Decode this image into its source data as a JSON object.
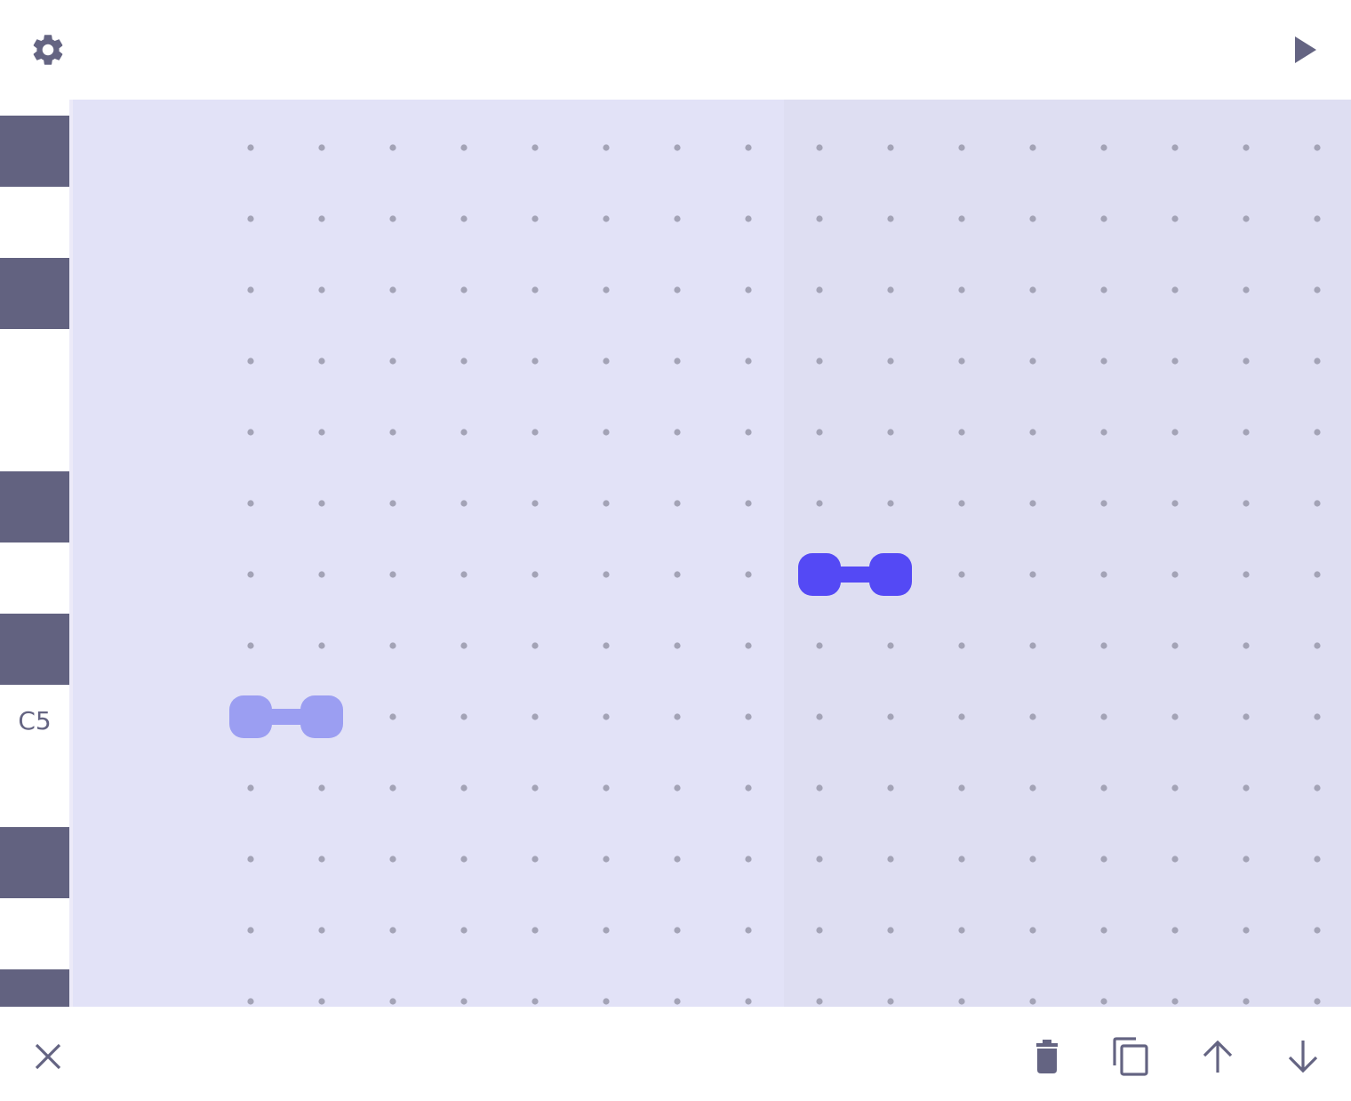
{
  "colors": {
    "icon": "#646482",
    "black_key": "#626280",
    "grid_bg_a": "#e2e2f7",
    "grid_bg_b": "#dedef2",
    "dot": "#a3a3b6",
    "note_active": "#5449f5",
    "note_ghost": "#9b9ef2"
  },
  "toolbar": {
    "settings_icon": "gear-icon",
    "play_icon": "play-icon"
  },
  "bottom_toolbar": {
    "close_icon": "close-icon",
    "delete_icon": "trash-icon",
    "copy_icon": "copy-icon",
    "up_icon": "arrow-up-icon",
    "down_icon": "arrow-down-icon"
  },
  "keyboard": {
    "label": "C5"
  },
  "grid": {
    "columns": 16,
    "rows": 13
  },
  "notes": [
    {
      "kind": "active",
      "row": 6,
      "col": 8,
      "length": 2
    },
    {
      "kind": "ghost",
      "row": 8,
      "col": 0,
      "length": 2
    }
  ]
}
